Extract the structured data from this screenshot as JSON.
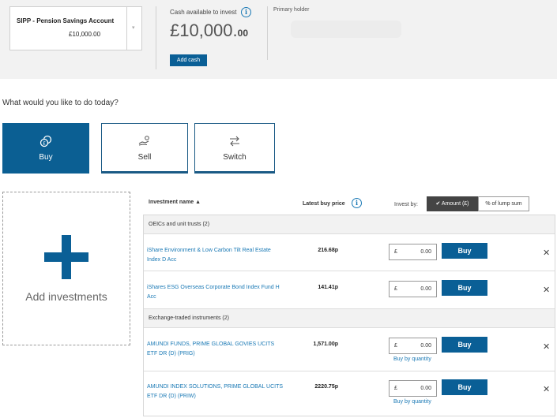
{
  "account": {
    "name": "SIPP - Pension Savings Account",
    "balance": "£10,000.00",
    "chevron": "▾"
  },
  "cash": {
    "label": "Cash available to invest",
    "amount_main": "£10,000.",
    "amount_pence": "00",
    "add_cash_label": "Add cash",
    "info_icon": "i"
  },
  "holder": {
    "label": "Primary holder"
  },
  "question": "What would you like to do today?",
  "actions": [
    {
      "label": "Buy",
      "icon": "coins-icon",
      "active": true
    },
    {
      "label": "Sell",
      "icon": "hand-coins-icon",
      "active": false
    },
    {
      "label": "Switch",
      "icon": "switch-arrows-icon",
      "active": false
    }
  ],
  "add_investments": {
    "label": "Add investments"
  },
  "table": {
    "col_name": "Investment name",
    "sort_indicator": "▲",
    "col_price": "Latest buy price",
    "invest_by_label": "Invest by:",
    "toggle_amount": "✔ Amount (£)",
    "toggle_lump": "% of lump sum",
    "groups": [
      {
        "title": "OEICs and unit trusts (2)",
        "rows": [
          {
            "name": "iShare Environment & Low Carbon Tilt Real Estate Index D Acc",
            "price": "216.68p",
            "currency": "£",
            "amount": "0.00",
            "buy_label": "Buy",
            "remove": "✕"
          },
          {
            "name": "iShares ESG Overseas Corporate Bond Index Fund H Acc",
            "price": "141.41p",
            "currency": "£",
            "amount": "0.00",
            "buy_label": "Buy",
            "remove": "✕"
          }
        ]
      },
      {
        "title": "Exchange-traded instruments (2)",
        "rows": [
          {
            "name": "AMUNDI FUNDS, PRIME GLOBAL GOVIES UCITS ETF DR (D) (PRIG)",
            "price": "1,571.00p",
            "currency": "£",
            "amount": "0.00",
            "buy_label": "Buy",
            "remove": "✕",
            "qty_link": "Buy by quantity"
          },
          {
            "name": "AMUNDI INDEX SOLUTIONS, PRIME GLOBAL UCITS ETF DR (D) (PRIW)",
            "price": "2220.75p",
            "currency": "£",
            "amount": "0.00",
            "buy_label": "Buy",
            "remove": "✕",
            "qty_link": "Buy by quantity"
          }
        ]
      }
    ]
  },
  "colors": {
    "primary": "#0a5f96",
    "link": "#1a79b5",
    "band": "#f2f2f2"
  }
}
